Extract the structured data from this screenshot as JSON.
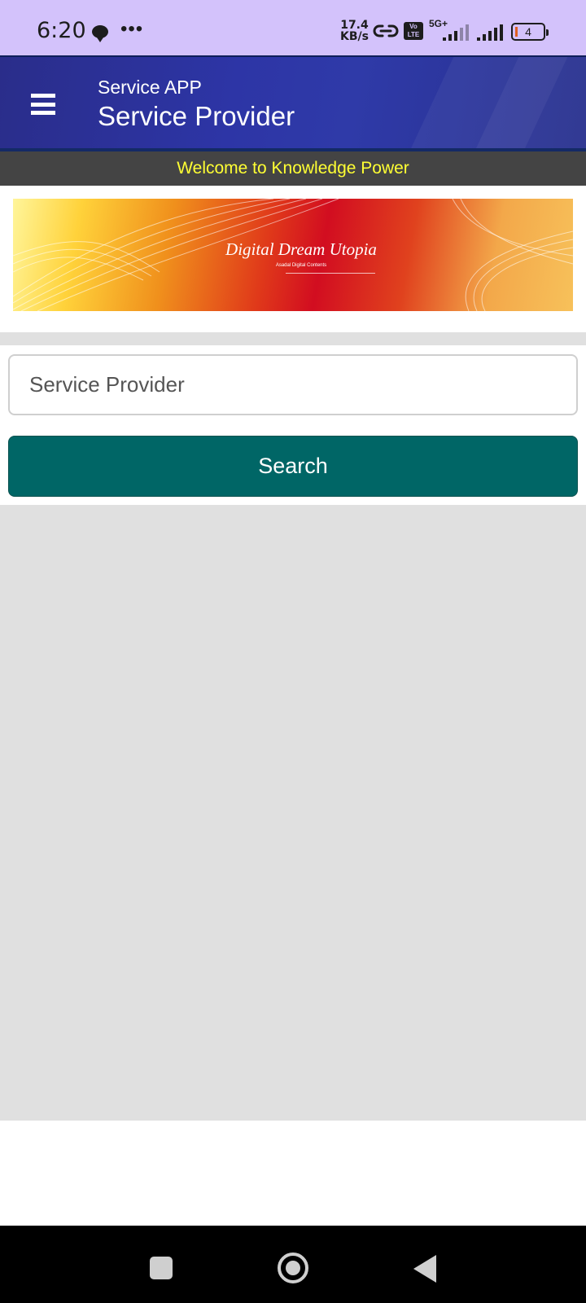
{
  "status_bar": {
    "time": "6:20",
    "dots": "•••",
    "speed_value": "17.4",
    "speed_unit": "KB/s",
    "volte_top": "Vo",
    "volte_bottom": "LTE",
    "network": "5G+",
    "battery": "4"
  },
  "app_bar": {
    "subtitle": "Service APP",
    "title": "Service Provider",
    "menu_icon": "hamburger-menu-icon"
  },
  "marquee": {
    "text": "Welcome to Knowledge Power"
  },
  "banner": {
    "title": "Digital Dream Utopia",
    "subtitle": "Asadal Digital Contents"
  },
  "search": {
    "placeholder": "Service Provider",
    "value": "",
    "button_label": "Search"
  },
  "colors": {
    "status_bar": "#d3c2fb",
    "app_bar": "#2d35a6",
    "marquee_bg": "#444444",
    "marquee_text": "#ffff33",
    "button": "#006666",
    "results_bg": "#e0e0e0"
  }
}
